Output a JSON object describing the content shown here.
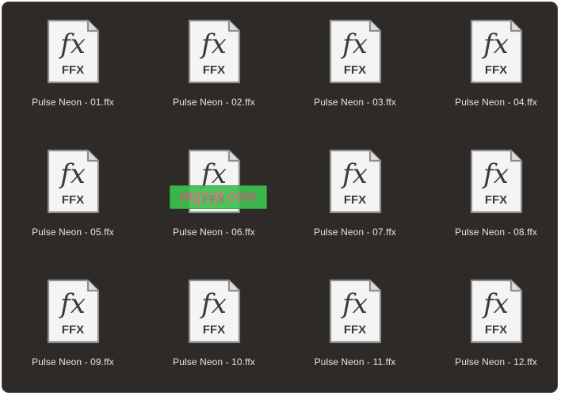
{
  "colors": {
    "background": "#2d2a27",
    "icon_page": "#f4f4f4",
    "icon_border": "#8e8e8e",
    "icon_text": "#3a3a3a",
    "label_text": "#e6e4e2",
    "watermark_bg": "#3fbf4f",
    "watermark_text": "#ff4d8f"
  },
  "icon": {
    "name": "ffx-document-icon",
    "glyph": "fx",
    "badge": "FFX"
  },
  "files": [
    {
      "name": "Pulse Neon - 01.ffx"
    },
    {
      "name": "Pulse Neon - 02.ffx"
    },
    {
      "name": "Pulse Neon - 03.ffx"
    },
    {
      "name": "Pulse Neon - 04.ffx"
    },
    {
      "name": "Pulse Neon - 05.ffx"
    },
    {
      "name": "Pulse Neon - 06.ffx"
    },
    {
      "name": "Pulse Neon - 07.ffx"
    },
    {
      "name": "Pulse Neon - 08.ffx"
    },
    {
      "name": "Pulse Neon - 09.ffx"
    },
    {
      "name": "Pulse Neon - 10.ffx"
    },
    {
      "name": "Pulse Neon - 11.ffx"
    },
    {
      "name": "Pulse Neon - 12.ffx"
    }
  ],
  "watermark": {
    "text": "mgzyjt.com"
  }
}
